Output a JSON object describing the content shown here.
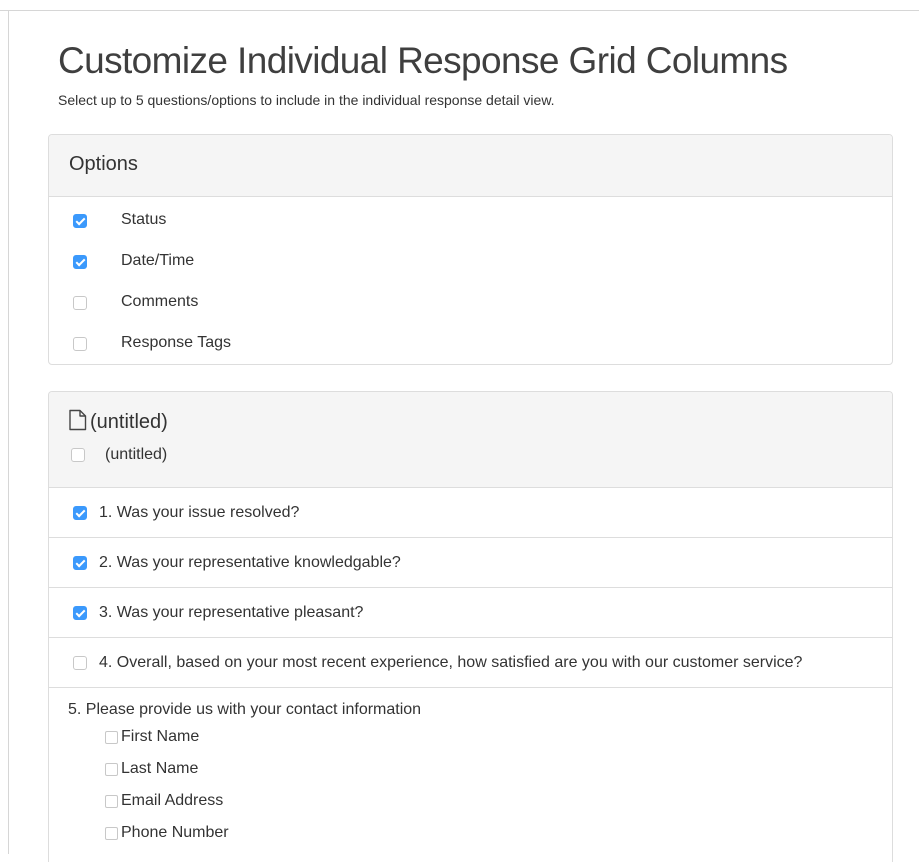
{
  "header": {
    "title": "Customize Individual Response Grid Columns",
    "subtitle": "Select up to 5 questions/options to include in the individual response detail view."
  },
  "options_panel": {
    "title": "Options",
    "items": [
      {
        "label": "Status",
        "checked": true
      },
      {
        "label": "Date/Time",
        "checked": true
      },
      {
        "label": "Comments",
        "checked": false
      },
      {
        "label": "Response Tags",
        "checked": false
      }
    ]
  },
  "page_panel": {
    "icon": "document-icon",
    "title": "(untitled)",
    "page_check": {
      "label": "(untitled)",
      "checked": false
    },
    "questions": [
      {
        "label": "1. Was your issue resolved?",
        "checked": true
      },
      {
        "label": "2. Was your representative knowledgable?",
        "checked": true
      },
      {
        "label": "3. Was your representative pleasant?",
        "checked": true
      },
      {
        "label": "4. Overall, based on your most recent experience, how satisfied are you with our customer service?",
        "checked": false
      }
    ],
    "contact": {
      "title": "5. Please provide us with your contact information",
      "fields": [
        {
          "label": "First Name",
          "checked": false
        },
        {
          "label": "Last Name",
          "checked": false
        },
        {
          "label": "Email Address",
          "checked": false
        },
        {
          "label": "Phone Number",
          "checked": false
        }
      ]
    }
  },
  "colors": {
    "checkbox_checked": "#3b99fc",
    "panel_header_bg": "#f5f5f5",
    "border": "#dddddd"
  }
}
